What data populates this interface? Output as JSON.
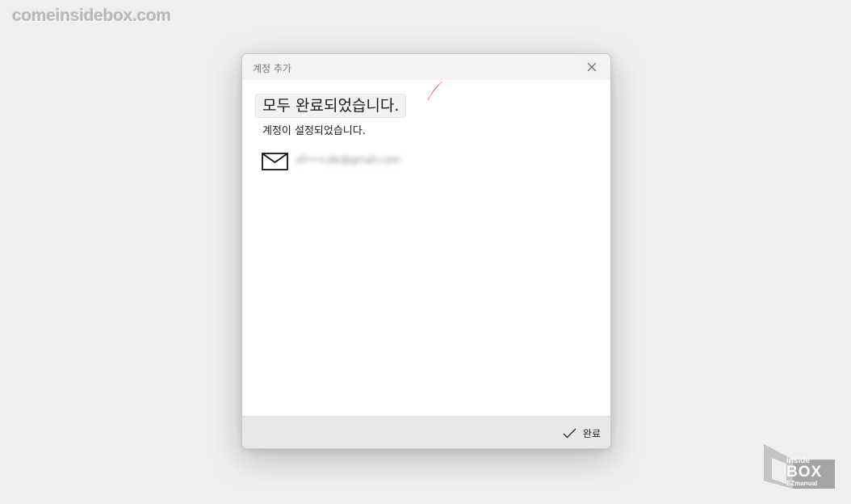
{
  "watermark": {
    "text": "comeinsidebox.com"
  },
  "dialog": {
    "title": "계정 추가",
    "close_icon": "close-icon",
    "headline": "모두 완료되었습니다.",
    "subtext": "계정이 설정되었습니다.",
    "account": {
      "icon": "mail-icon",
      "email": "ef•••cde@gmail.com"
    },
    "footer": {
      "done_label": "완료",
      "done_icon": "check-icon"
    }
  },
  "logo": {
    "line1": "inside",
    "line2": "BOX",
    "line3": "EZmanual"
  },
  "colors": {
    "highlight_check": "#e8578b",
    "background": "#efefef"
  }
}
